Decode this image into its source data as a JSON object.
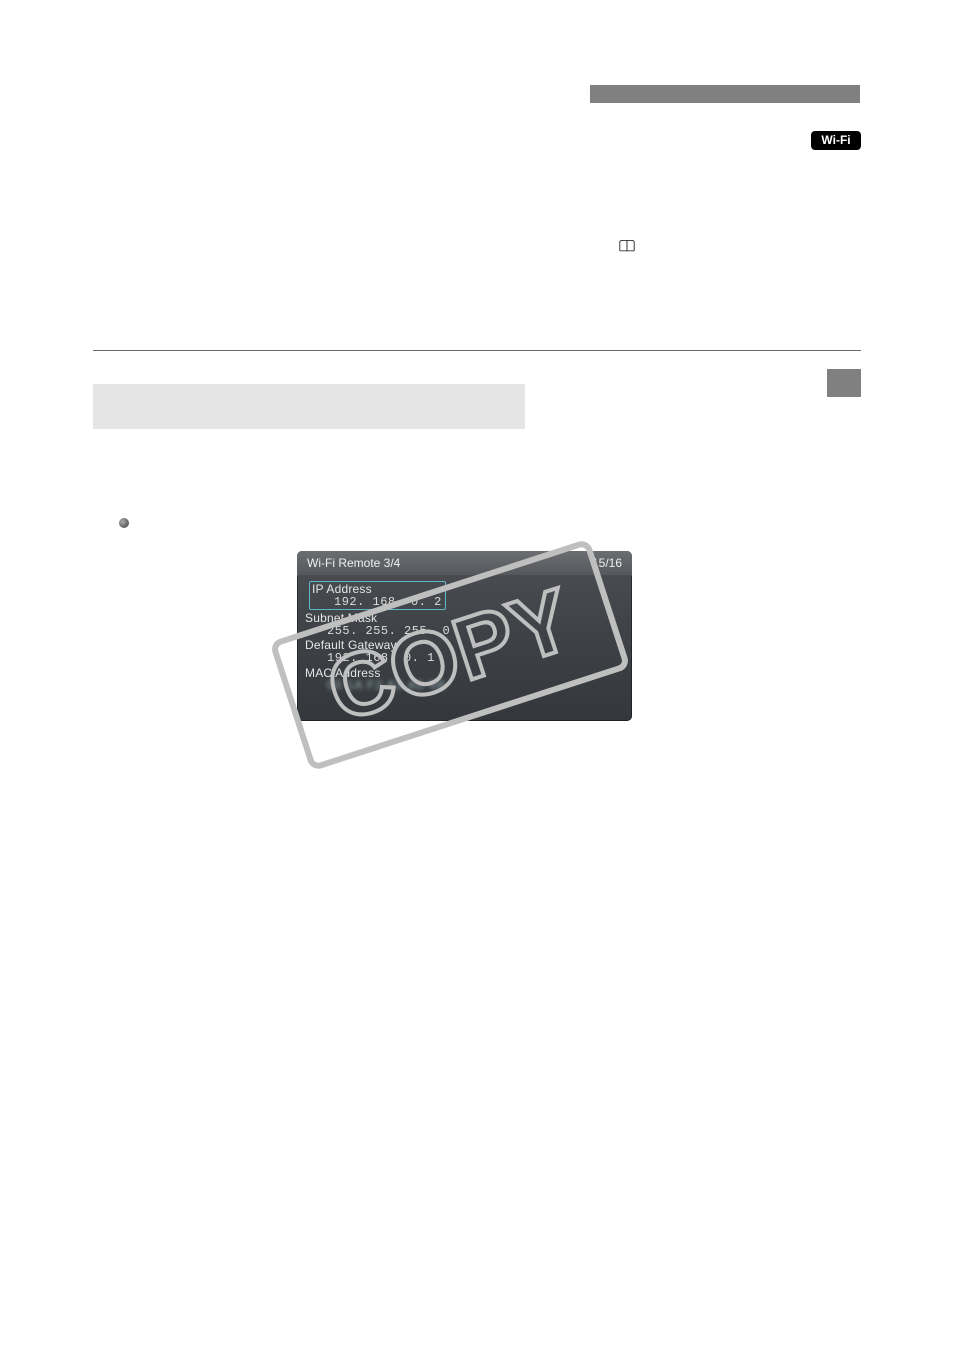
{
  "header": {
    "wifi_badge": "Wi-Fi"
  },
  "camera_menu": {
    "title": "Wi-Fi Remote 3/4",
    "page_indicator": "15/16",
    "rows": [
      {
        "label": "IP Address",
        "value": "192. 168. 0. 2",
        "selected": true
      },
      {
        "label": "Subnet Mask",
        "value": "255. 255. 255. 0",
        "selected": false
      },
      {
        "label": "Default Gateway",
        "value": "192. 168. 0. 1",
        "selected": false
      },
      {
        "label": "MAC Address",
        "value": "",
        "selected": false,
        "blurred": true
      }
    ]
  },
  "watermark": "COPY"
}
